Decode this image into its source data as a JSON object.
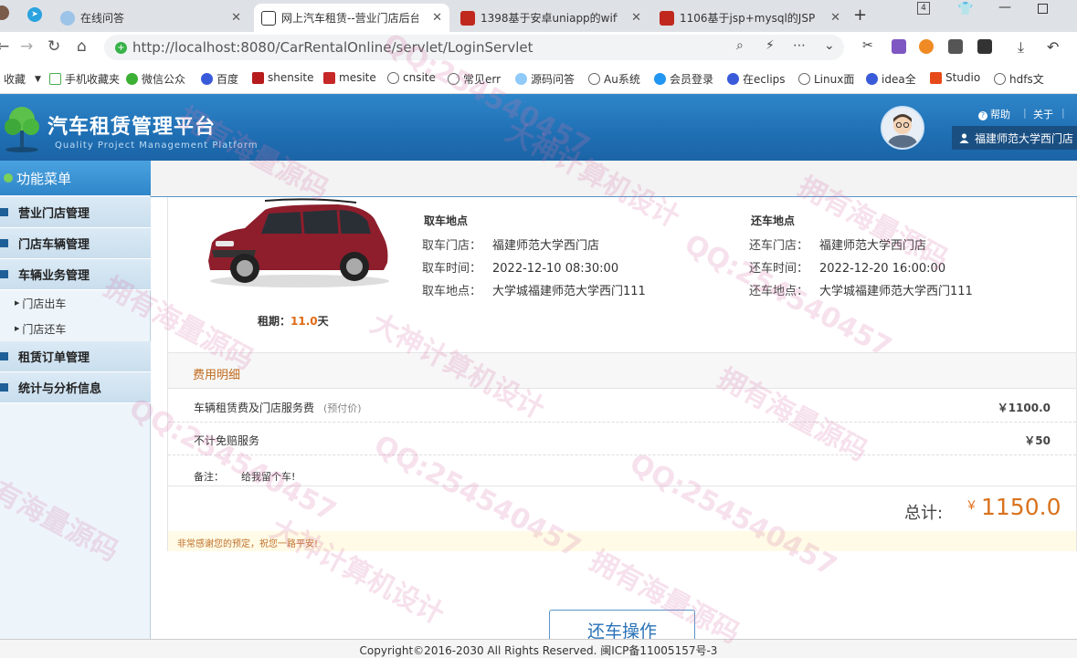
{
  "browser": {
    "tabs": [
      {
        "title": "在线问答",
        "active": false
      },
      {
        "title": "网上汽车租赁--营业门店后台",
        "active": true
      },
      {
        "title": "1398基于安卓uniapp的wifi",
        "active": false
      },
      {
        "title": "1106基于jsp+mysql的JSP",
        "active": false
      }
    ],
    "tab_count_badge": "4",
    "url": "http://localhost:8080/CarRentalOnline/servlet/LoginServlet",
    "bookmarks": [
      "收藏",
      "手机收藏夹",
      "微信公众",
      "百度",
      "shensite",
      "mesite",
      "cnsite",
      "常见err",
      "源码问答",
      "Au系统",
      "会员登录",
      "在eclips",
      "Linux面",
      "idea全",
      "Studio",
      "hdfs文"
    ]
  },
  "header": {
    "title": "汽车租赁管理平台",
    "subtitle": "Quality Project Management Platform",
    "help": "帮助",
    "about": "关于",
    "user": "福建师范大学西门店"
  },
  "sidebar": {
    "heading": "功能菜单",
    "menus": [
      {
        "label": "营业门店管理"
      },
      {
        "label": "门店车辆管理"
      },
      {
        "label": "车辆业务管理",
        "children": [
          "门店出车",
          "门店还车"
        ]
      },
      {
        "label": "租赁订单管理"
      },
      {
        "label": "统计与分析信息"
      }
    ]
  },
  "order": {
    "pickup": {
      "heading": "取车地点",
      "store_label": "取车门店：",
      "store": "福建师范大学西门店",
      "time_label": "取车时间：",
      "time": "2022-12-10 08:30:00",
      "addr_label": "取车地点：",
      "addr": "大学城福建师范大学西门111"
    },
    "return": {
      "heading": "还车地点",
      "store_label": "还车门店：",
      "store": "福建师范大学西门店",
      "time_label": "还车时间：",
      "time": "2022-12-20 16:00:00",
      "addr_label": "还车地点：",
      "addr": "大学城福建师范大学西门111"
    },
    "period_label": "租期：",
    "period_value": "11.0",
    "period_unit": "天"
  },
  "fees": {
    "title": "费用明细",
    "rows": [
      {
        "name": "车辆租赁费及门店服务费",
        "note": "(预付价)",
        "value": "￥1100.0"
      },
      {
        "name": "不计免赔服务",
        "note": "",
        "value": "￥50"
      }
    ],
    "remark_label": "备注：",
    "remark": "给我留个车!",
    "total_label": "总计:",
    "total_symbol": "￥",
    "total_value": "1150.0",
    "thanks": "非常感谢您的预定，祝您一路平安!"
  },
  "actions": {
    "return_button": "还车操作"
  },
  "footer": "Copyright©2016-2030 All Rights Reserved. 闽ICP备11005157号-3",
  "watermarks": [
    "拥有海量源码",
    "大神计算机设计",
    "QQ:254540457"
  ]
}
